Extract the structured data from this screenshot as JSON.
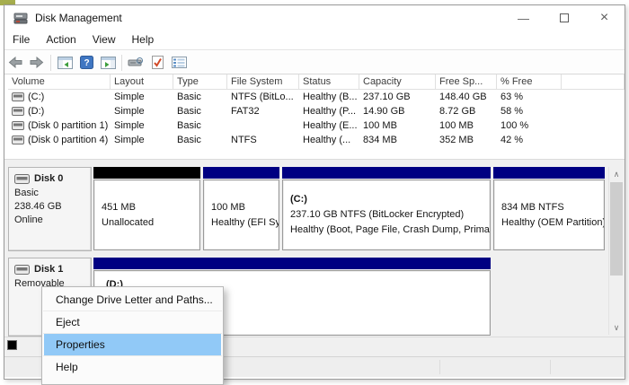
{
  "window": {
    "title": "Disk Management",
    "controls": {
      "minimize": "—",
      "close": "×"
    }
  },
  "menubar": {
    "items": [
      "File",
      "Action",
      "View",
      "Help"
    ]
  },
  "toolbar": {
    "icons": [
      "back-icon",
      "forward-icon",
      "show-console-tree-icon",
      "help-icon",
      "show-action-pane-icon",
      "disk-tool-icon",
      "check-document-icon",
      "properties-list-icon"
    ]
  },
  "volume_list": {
    "columns": [
      "Volume",
      "Layout",
      "Type",
      "File System",
      "Status",
      "Capacity",
      "Free Sp...",
      "% Free"
    ],
    "rows": [
      {
        "volume": "(C:)",
        "layout": "Simple",
        "type": "Basic",
        "fs": "NTFS (BitLo...",
        "status": "Healthy (B...",
        "capacity": "237.10 GB",
        "free": "148.40 GB",
        "pct": "63 %"
      },
      {
        "volume": "(D:)",
        "layout": "Simple",
        "type": "Basic",
        "fs": "FAT32",
        "status": "Healthy (P...",
        "capacity": "14.90 GB",
        "free": "8.72 GB",
        "pct": "58 %"
      },
      {
        "volume": "(Disk 0 partition 1)",
        "layout": "Simple",
        "type": "Basic",
        "fs": "",
        "status": "Healthy (E...",
        "capacity": "100 MB",
        "free": "100 MB",
        "pct": "100 %"
      },
      {
        "volume": "(Disk 0 partition 4)",
        "layout": "Simple",
        "type": "Basic",
        "fs": "NTFS",
        "status": "Healthy (...",
        "capacity": "834 MB",
        "free": "352 MB",
        "pct": "42 %"
      }
    ]
  },
  "disks": [
    {
      "name": "Disk 0",
      "line1": "Basic",
      "line2": "238.46 GB",
      "line3": "Online",
      "partitions": [
        {
          "line1": "451 MB",
          "line2": "Unallocated"
        },
        {
          "line1": "100 MB",
          "line2": "Healthy (EFI Sy"
        },
        {
          "title": "(C:)",
          "line1": "237.10 GB NTFS (BitLocker Encrypted)",
          "line2": "Healthy (Boot, Page File, Crash Dump, Primar"
        },
        {
          "line1": "834 MB NTFS",
          "line2": "Healthy (OEM Partition)"
        }
      ]
    },
    {
      "name": "Disk 1",
      "line1": "Removable",
      "partitions": [
        {
          "title": "(D:)"
        }
      ]
    }
  ],
  "context_menu": {
    "items": [
      "Change Drive Letter and Paths...",
      "Eject",
      "Properties",
      "Help"
    ],
    "highlighted_item": "Properties"
  },
  "colors": {
    "primary_partition": "#000082",
    "unallocated": "#000000",
    "menu_highlight": "#91c9f7"
  }
}
